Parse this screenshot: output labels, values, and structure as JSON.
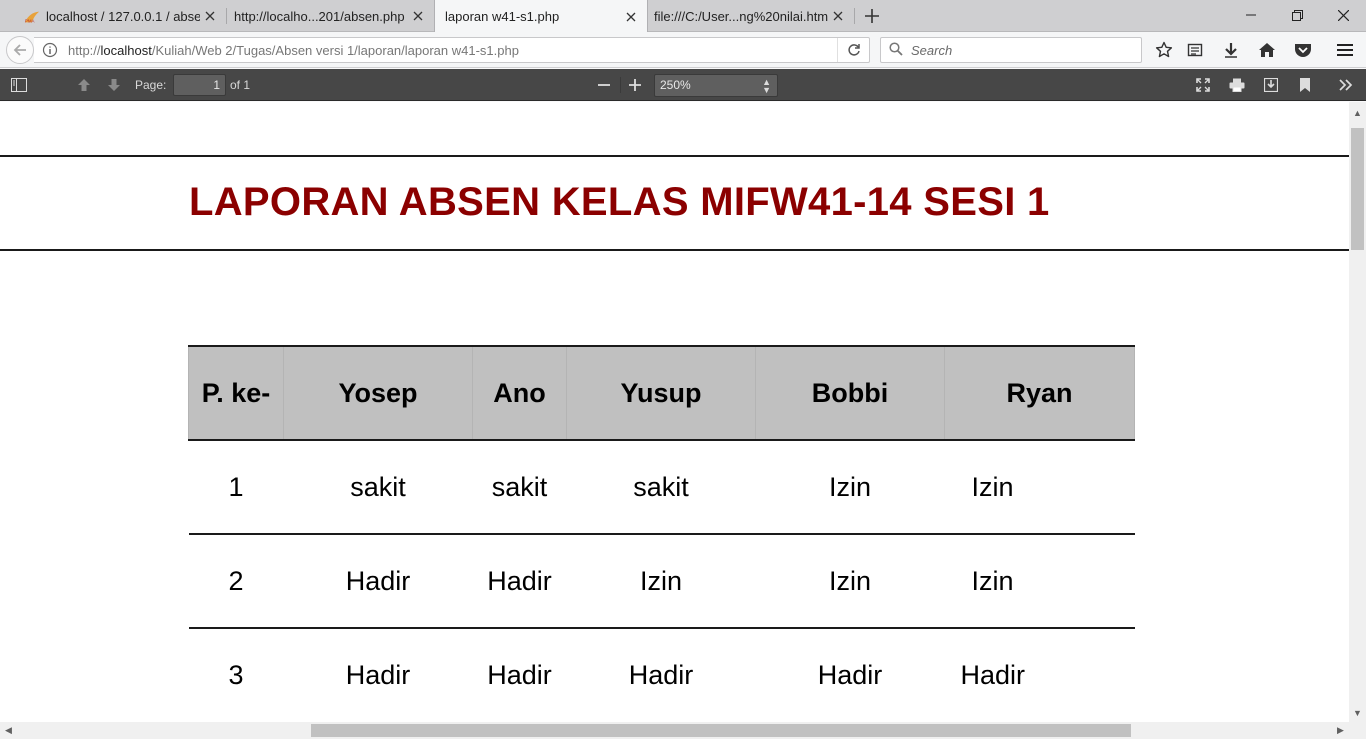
{
  "browser": {
    "tabs": [
      {
        "title": "localhost / 127.0.0.1 / abse...",
        "favicon": "phpmyadmin-icon",
        "active": false
      },
      {
        "title": "http://localho...201/absen.php",
        "favicon": "none",
        "active": false
      },
      {
        "title": "laporan w41-s1.php",
        "favicon": "none",
        "active": true
      },
      {
        "title": "file:///C:/User...ng%20nilai.html",
        "favicon": "none",
        "active": false
      }
    ],
    "url_prefix": "http://",
    "url_host": "localhost",
    "url_path": "/Kuliah/Web 2/Tugas/Absen versi 1/laporan/laporan w41-s1.php",
    "search_placeholder": "Search"
  },
  "pdf_toolbar": {
    "page_label": "Page:",
    "page_value": "1",
    "page_total": "of 1",
    "zoom": "250%"
  },
  "document": {
    "title": "LAPORAN ABSEN KELAS MIFW41-14 SESI 1",
    "title_color": "#8b0000",
    "headers": [
      "P. ke-",
      "Yosep",
      "Ano",
      "Yusup",
      "Bobbi",
      "Ryan"
    ],
    "rows": [
      [
        "1",
        "sakit",
        "sakit",
        "sakit",
        "Izin",
        "Izin"
      ],
      [
        "2",
        "Hadir",
        "Hadir",
        "Izin",
        "Izin",
        "Izin"
      ],
      [
        "3",
        "Hadir",
        "Hadir",
        "Hadir",
        "Hadir",
        "Hadir"
      ]
    ]
  }
}
